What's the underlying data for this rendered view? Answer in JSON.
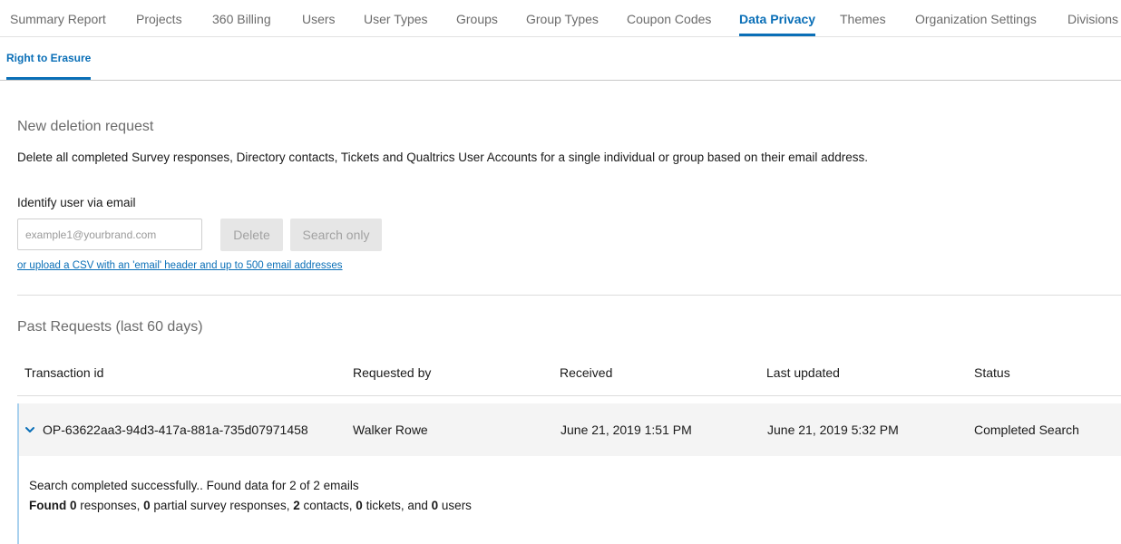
{
  "top_tabs": [
    {
      "label": "Summary Report",
      "active": false
    },
    {
      "label": "Projects",
      "active": false
    },
    {
      "label": "360 Billing",
      "active": false
    },
    {
      "label": "Users",
      "active": false
    },
    {
      "label": "User Types",
      "active": false
    },
    {
      "label": "Groups",
      "active": false
    },
    {
      "label": "Group Types",
      "active": false
    },
    {
      "label": "Coupon Codes",
      "active": false
    },
    {
      "label": "Data Privacy",
      "active": true
    },
    {
      "label": "Themes",
      "active": false
    },
    {
      "label": "Organization Settings",
      "active": false
    },
    {
      "label": "Divisions",
      "active": false
    }
  ],
  "sub_tabs": [
    {
      "label": "Right to Erasure",
      "active": true
    }
  ],
  "new_request": {
    "title": "New deletion request",
    "description": "Delete all completed Survey responses, Directory contacts, Tickets and Qualtrics User Accounts for a single individual or group based on their email address.",
    "email_label": "Identify user via email",
    "email_value": "",
    "email_placeholder": "example1@yourbrand.com",
    "delete_label": "Delete",
    "search_label": "Search only",
    "upload_link": "or upload a CSV with an 'email' header and up to 500 email addresses"
  },
  "past_requests": {
    "title": "Past Requests (last 60 days)",
    "columns": [
      "Transaction id",
      "Requested by",
      "Received",
      "Last updated",
      "Status"
    ],
    "rows": [
      {
        "transaction_id": "OP-63622aa3-94d3-417a-881a-735d07971458",
        "requested_by": "Walker Rowe",
        "received": "June 21, 2019 1:51 PM",
        "last_updated": "June 21, 2019 5:32 PM",
        "status": "Completed Search",
        "expanded": true,
        "detail_line1": "Search completed successfully.. Found data for 2 of 2 emails",
        "detail_line2": {
          "found_label": "Found",
          "responses_count": "0",
          "responses_label": "responses,",
          "partial_count": "0",
          "partial_label": "partial survey responses,",
          "contacts_count": "2",
          "contacts_label": "contacts,",
          "tickets_count": "0",
          "tickets_label": "tickets, and",
          "users_count": "0",
          "users_label": "users"
        }
      }
    ]
  },
  "colors": {
    "accent": "#0a6fb7",
    "muted_text": "#6b6b6b",
    "row_highlight": "#f4f4f4",
    "row_border": "#a9d1ee"
  },
  "icons": {
    "row_toggle": "chevron-down-icon"
  }
}
